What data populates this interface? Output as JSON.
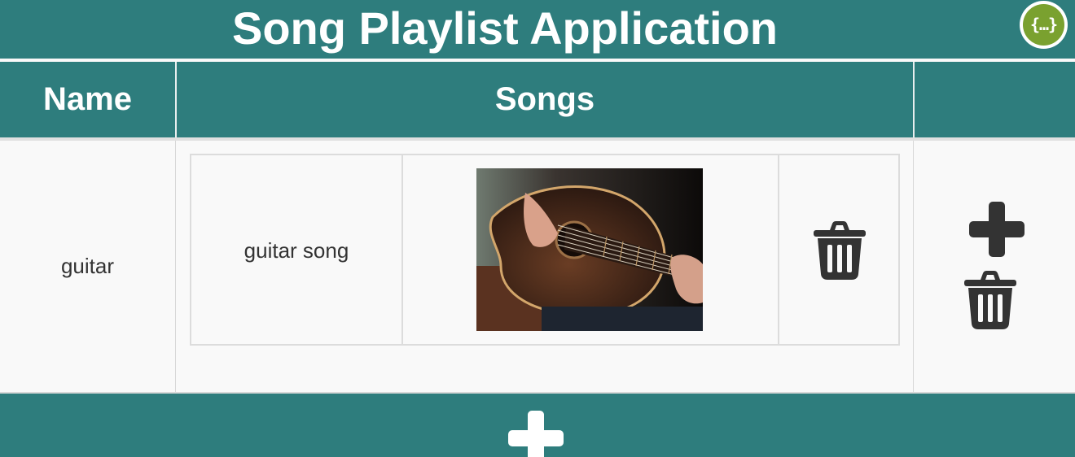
{
  "app": {
    "title": "Song Playlist Application",
    "api_badge_icon": "curly-braces-icon",
    "api_badge_text": "{…}"
  },
  "table": {
    "headers": [
      "Name",
      "Songs",
      ""
    ]
  },
  "playlists": [
    {
      "name": "guitar",
      "songs": [
        {
          "title": "guitar song",
          "image_icon": "acoustic-guitar-photo",
          "delete_icon": "trash-icon"
        }
      ],
      "add_icon": "plus-icon",
      "delete_icon": "trash-icon"
    }
  ],
  "footer": {
    "add_icon": "plus-icon"
  },
  "colors": {
    "teal": "#2e7d7d",
    "badge_green": "#7aa12f",
    "icon_dark": "#333333"
  }
}
